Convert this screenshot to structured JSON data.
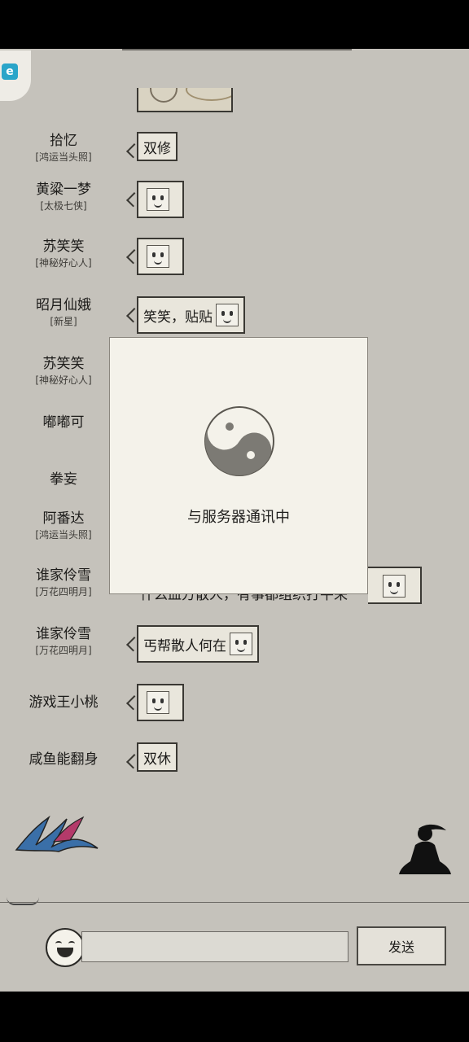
{
  "chat": {
    "messages": [
      {
        "nick": "拾忆",
        "title": "[鸿运当头照]",
        "text": "双修",
        "face": false
      },
      {
        "nick": "黄粱一梦",
        "title": "[太极七侠]",
        "text": "",
        "face": true
      },
      {
        "nick": "苏笑笑",
        "title": "[神秘好心人]",
        "text": "",
        "face": true
      },
      {
        "nick": "昭月仙娥",
        "title": "[新星]",
        "text": "笑笑，贴贴",
        "face": true
      },
      {
        "nick": "苏笑笑",
        "title": "[神秘好心人]",
        "text": "",
        "face": false
      },
      {
        "nick": "嘟嘟可",
        "title": "",
        "text": "",
        "face": false
      },
      {
        "nick": "拳妄",
        "title": "",
        "text": "",
        "face": false
      },
      {
        "nick": "阿番达",
        "title": "[鸿运当头照]",
        "text": "",
        "face": false
      },
      {
        "nick": "谁家伶雪",
        "title": "[万花四明月]",
        "text": "",
        "face": false
      },
      {
        "nick": "谁家伶雪",
        "title": "[万花四明月]",
        "text": "丐帮散人何在",
        "face": true
      },
      {
        "nick": "游戏王小桃",
        "title": "",
        "text": "",
        "face": true
      },
      {
        "nick": "咸鱼能翻身",
        "title": "",
        "text": "双休",
        "face": false
      }
    ],
    "partial_bubble_text": "什么血方散人，有事都组织打平来"
  },
  "modal": {
    "text": "与服务器通讯中"
  },
  "input": {
    "placeholder": "",
    "send_label": "发送"
  },
  "colors": {
    "background": "#c5c2bb",
    "bubble": "#e9e6dc",
    "modal": "#f4f2ea"
  }
}
